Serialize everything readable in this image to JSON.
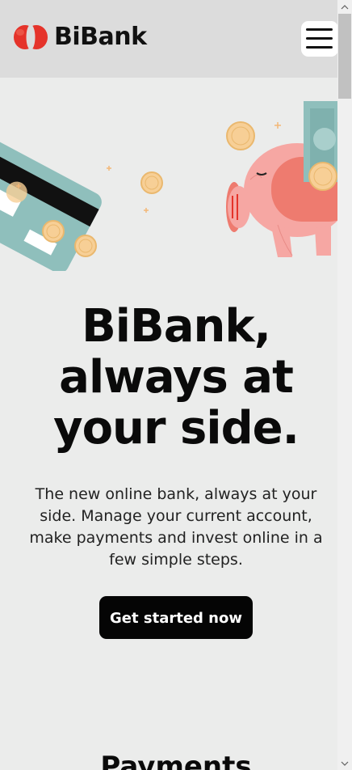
{
  "header": {
    "brand_name": "BiBank",
    "logo_color": "#e5332a"
  },
  "hero": {
    "title_line1": "BiBank,",
    "title_line2": "always at",
    "title_line3": "your side.",
    "description": "The new online bank, always at your side. Manage your current account, make payments and invest online in a few simple steps.",
    "cta_label": "Get started now"
  },
  "next_section": {
    "title": "Payments"
  },
  "colors": {
    "card": "#8fbfbc",
    "coin": "#f7cf96",
    "piggy": "#f6a7a3",
    "piggy_slot": "#ee7b6f",
    "cta_bg": "#050505"
  },
  "icons": {
    "menu": "hamburger-icon",
    "scroll_up": "chevron-up-icon",
    "scroll_down": "chevron-down-icon"
  }
}
